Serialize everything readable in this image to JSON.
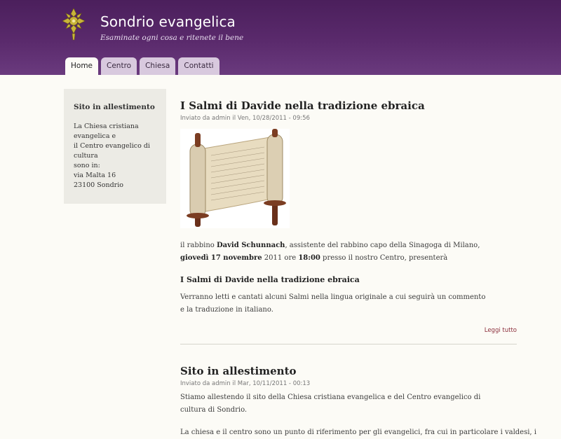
{
  "header": {
    "site_name": "Sondrio evangelica",
    "slogan": "Esaminate ogni cosa e ritenete il bene",
    "logo_icon": "cross-emblem-icon",
    "tabs": [
      {
        "label": "Home",
        "active": true
      },
      {
        "label": "Centro",
        "active": false
      },
      {
        "label": "Chiesa",
        "active": false
      },
      {
        "label": "Contatti",
        "active": false
      }
    ]
  },
  "sidebar": {
    "title": "Sito in allestimento",
    "lines": [
      "La Chiesa cristiana",
      "evangelica e",
      "il Centro evangelico di",
      "cultura",
      "sono in:",
      "via Malta 16",
      "23100 Sondrio"
    ]
  },
  "nodes": [
    {
      "title": "I Salmi di Davide nella tradizione ebraica",
      "submitted": "Inviato da admin il Ven, 10/28/2011 - 09:56",
      "image_icon": "torah-scroll-image",
      "p1": {
        "a": "il rabbino ",
        "b": "David Schunnach",
        "c": ", assistente del rabbino capo della Sinagoga di Milano,",
        "d": "giovedì 17 novembre",
        "e": " 2011 ore ",
        "f": "18:00",
        "g": " presso il nostro Centro, presenterà"
      },
      "heading": "I Salmi di Davide nella tradizione ebraica",
      "p2": "Verranno letti e cantati alcuni Salmi nella lingua originale a cui seguirà un commento e la traduzione in italiano.",
      "read_more": "Leggi tutto"
    },
    {
      "title": "Sito in allestimento",
      "submitted": "Inviato da admin il Mar, 10/11/2011 - 00:13",
      "p1": "Stiamo allestendo il sito della Chiesa cristiana evangelica e del Centro evangelico di cultura di Sondrio.",
      "p2": "La chiesa e il centro sono un punto di riferimento per gli evangelici, fra cui in particolare i valdesi, i"
    }
  ],
  "colors": {
    "header_top": "#4b1f5c",
    "header_bottom": "#6a3a7e",
    "tab_inactive": "#d8c9de",
    "link": "#8b2d3b",
    "sidebar_bg": "#ecebe5"
  }
}
